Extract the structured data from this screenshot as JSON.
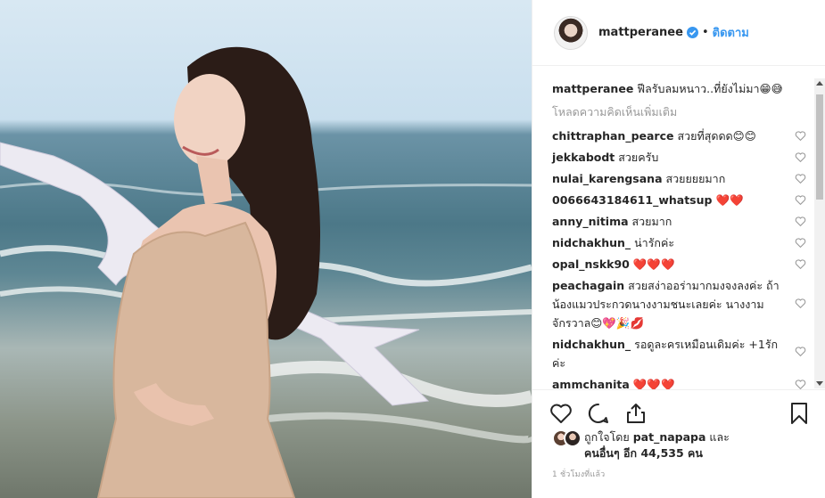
{
  "post": {
    "username": "mattperanee",
    "follow_label": "ติดตาม",
    "separator": "•",
    "caption_text": "ฟีลรับลมหนาว..ที่ยังไม่มา😁😅",
    "load_more": "โหลดความคิดเห็นเพิ่มเติม",
    "photo_alt": "woman in beige dress on beach with white ribbon"
  },
  "comments": [
    {
      "user": "chittraphan_pearce",
      "text": "สวยที่สุดดด😊😊"
    },
    {
      "user": "jekkabodt",
      "text": "สวยครับ"
    },
    {
      "user": "nulai_karengsana",
      "text": "สวยยยยมาก"
    },
    {
      "user": "0066643184611_whatsup",
      "text": "❤️❤️"
    },
    {
      "user": "anny_nitima",
      "text": "สวยมาก"
    },
    {
      "user": "nidchakhun_",
      "text": "น่ารักค่ะ"
    },
    {
      "user": "opal_nskk90",
      "text": "❤️❤️❤️"
    },
    {
      "user": "peachagain",
      "text": "สวยสง่าออร่ามากมงจงลงค่ะ ถ้าน้องแมวประกวดนางงามชนะเลยค่ะ นางงามจักรวาล😊💖🎉💋"
    },
    {
      "user": "nidchakhun_",
      "text": "รอดูละครเหมือนเดิมค่ะ +1รักค่ะ"
    },
    {
      "user": "ammchanita",
      "text": "❤️❤️❤️"
    }
  ],
  "likes": {
    "prefix": "ถูกใจโดย",
    "first_user": "pat_napapa",
    "and": "และ",
    "others": "คนอื่นๆ อีก 44,535 คน"
  },
  "timestamp": "1 ชั่วโมงที่แล้ว",
  "colors": {
    "accent": "#3897f0",
    "text": "#262626",
    "muted": "#999999",
    "heart": "#e0102a"
  },
  "icons": [
    "verified-badge-icon",
    "heart-outline-icon",
    "comment-icon",
    "share-icon",
    "bookmark-icon"
  ]
}
